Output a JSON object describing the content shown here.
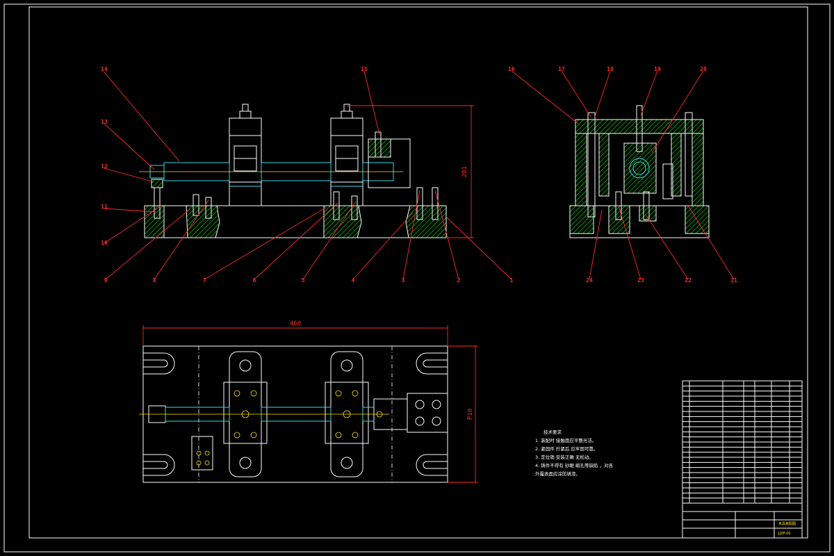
{
  "callouts": {
    "c1": "1",
    "c2": "2",
    "c3": "3",
    "c4": "4",
    "c5": "5",
    "c6": "6",
    "c7": "7",
    "c8": "8",
    "c9": "9",
    "c10": "10",
    "c11": "11",
    "c12": "12",
    "c13": "13",
    "c14": "14",
    "c15": "15",
    "c16": "16",
    "c17": "17",
    "c18": "18",
    "c19": "19",
    "c20": "20",
    "c21": "21",
    "c22": "22",
    "c23": "23",
    "c24": "24"
  },
  "dimensions": {
    "height": "281",
    "width": "460",
    "depth": "P10"
  },
  "tech_notes": {
    "title": "技术要求",
    "lines": [
      "1. 装配时 接触面应平整光洁。",
      "2. 紧固件 拧紧后 应牢固可靠。",
      "3. 定位销 安装正确 无松动。",
      "4. 铸件不得有 砂眼 缩孔等缺陷 ，对各",
      "外露表面应涂防锈漆。"
    ]
  },
  "title_block": {
    "drawing_name": "夹具装配图",
    "drawing_number": "JJZP-00"
  },
  "colors": {
    "line": "#ffffff",
    "dimension": "#ff2a2a",
    "centerline": "#ffe600",
    "cyan": "#3ad7e8",
    "hatch": "#00c000"
  }
}
